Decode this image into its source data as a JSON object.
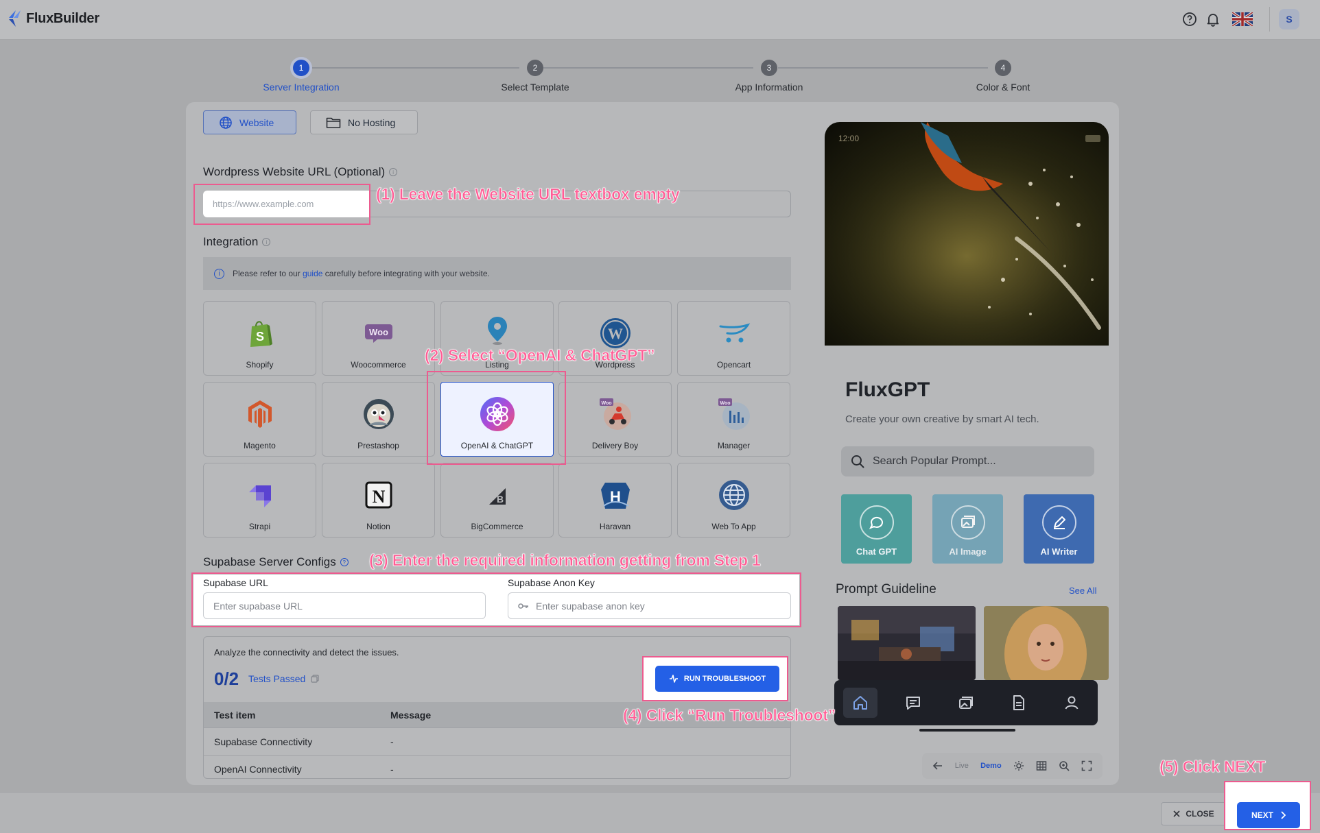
{
  "app": {
    "name": "FluxBuilder",
    "avatar_initial": "S",
    "flag": "uk-flag-icon"
  },
  "steps": [
    {
      "number": "1",
      "label": "Server Integration",
      "active": true
    },
    {
      "number": "2",
      "label": "Select Template",
      "active": false
    },
    {
      "number": "3",
      "label": "App Information",
      "active": false
    },
    {
      "number": "4",
      "label": "Color & Font",
      "active": false
    }
  ],
  "hosting_tabs": {
    "website": "Website",
    "no_hosting": "No Hosting"
  },
  "website_url": {
    "label": "Wordpress Website URL (Optional)",
    "placeholder": "https://www.example.com",
    "value": ""
  },
  "integration": {
    "title": "Integration",
    "notice_pre": "Please refer to our ",
    "notice_link": "guide",
    "notice_post": " carefully before integrating with your website.",
    "items": [
      {
        "label": "Shopify",
        "icon": "shopify-icon"
      },
      {
        "label": "Woocommerce",
        "icon": "woocommerce-icon"
      },
      {
        "label": "Listing",
        "icon": "map-pin-icon"
      },
      {
        "label": "Wordpress",
        "icon": "wordpress-icon"
      },
      {
        "label": "Opencart",
        "icon": "opencart-icon"
      },
      {
        "label": "Magento",
        "icon": "magento-icon"
      },
      {
        "label": "Prestashop",
        "icon": "prestashop-icon"
      },
      {
        "label": "OpenAI & ChatGPT",
        "icon": "openai-icon",
        "selected": true
      },
      {
        "label": "Delivery Boy",
        "icon": "delivery-boy-icon"
      },
      {
        "label": "Manager",
        "icon": "manager-icon"
      },
      {
        "label": "Strapi",
        "icon": "strapi-icon"
      },
      {
        "label": "Notion",
        "icon": "notion-icon"
      },
      {
        "label": "BigCommerce",
        "icon": "bigcommerce-icon"
      },
      {
        "label": "Haravan",
        "icon": "haravan-icon"
      },
      {
        "label": "Web To App",
        "icon": "globe-icon"
      }
    ]
  },
  "supabase": {
    "title": "Supabase Server Configs",
    "url_label": "Supabase URL",
    "url_placeholder": "Enter supabase URL",
    "key_label": "Supabase Anon Key",
    "key_placeholder": "Enter supabase anon key"
  },
  "troubleshoot": {
    "description": "Analyze the connectivity and detect the issues.",
    "score": "0/2",
    "passed_label": "Tests Passed",
    "run_label": "RUN TROUBLESHOOT",
    "columns": [
      "Test item",
      "Message"
    ],
    "rows": [
      {
        "item": "Supabase Connectivity",
        "message": "-"
      },
      {
        "item": "OpenAI Connectivity",
        "message": "-"
      }
    ]
  },
  "preview": {
    "status_time": "12:00",
    "title": "FluxGPT",
    "subtitle": "Create your own creative by smart AI tech.",
    "search_placeholder": "Search Popular Prompt...",
    "tiles": [
      {
        "label": "Chat GPT",
        "color": "#4e9e9c"
      },
      {
        "label": "AI Image",
        "color": "#6aa0b5"
      },
      {
        "label": "AI Writer",
        "color": "#3e6ab0"
      }
    ],
    "guide_title": "Prompt Guideline",
    "see_all": "See All",
    "tools": {
      "live": "Live",
      "demo": "Demo"
    }
  },
  "footer": {
    "close": "CLOSE",
    "next": "NEXT"
  },
  "annotations": {
    "a1": "(1) Leave the Website URL textbox empty",
    "a2": "(2) Select “OpenAI & ChatGPT”",
    "a3": "(3) Enter the required information getting from Step 1",
    "a4": "(4) Click “Run Troubleshoot”",
    "a5": "(5) Click NEXT"
  },
  "colors": {
    "accent": "#2460e6",
    "annotation": "#ff5d95",
    "overlay": "#a9aaac"
  }
}
